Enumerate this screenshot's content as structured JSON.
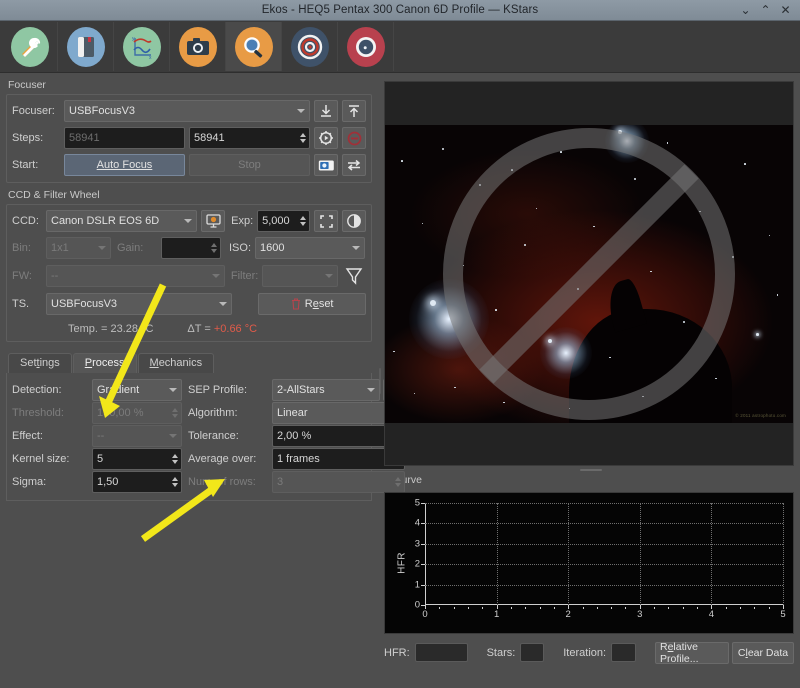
{
  "window": {
    "title": "Ekos - HEQ5 Pentax 300 Canon 6D Profile — KStars",
    "minimize_icon": "chevron-down-icon",
    "maximize_icon": "chevron-up-icon",
    "close_icon": "close-icon"
  },
  "toolbar": {
    "modules": [
      {
        "name": "setup-module",
        "icon": "wrench-screwdriver-icon"
      },
      {
        "name": "scheduler-module",
        "icon": "notebook-icon"
      },
      {
        "name": "analyze-module",
        "icon": "graph-icon"
      },
      {
        "name": "capture-module",
        "icon": "camera-icon"
      },
      {
        "name": "focus-module",
        "icon": "magnifier-icon"
      },
      {
        "name": "align-module",
        "icon": "target-icon"
      },
      {
        "name": "guide-module",
        "icon": "guide-compass-icon"
      }
    ],
    "selected_index": 4
  },
  "focuser": {
    "group_label": "Focuser",
    "device_label": "Focuser:",
    "device_value": "USBFocusV3",
    "steps_label": "Steps:",
    "steps_placeholder": "58941",
    "steps_value": "58941",
    "start_label": "Start:",
    "auto_focus_label": "Auto Focus",
    "stop_label": "Stop",
    "focus_in_icon": "arrow-down-icon",
    "focus_out_icon": "arrow-up-icon",
    "goto_icon": "gear-play-icon",
    "abort_icon": "stop-circle-icon",
    "capture_icon": "camera-capture-icon",
    "loop_icon": "loop-icon"
  },
  "ccd": {
    "group_label": "CCD & Filter Wheel",
    "ccd_label": "CCD:",
    "ccd_value": "Canon DSLR EOS 6D",
    "ccd_settings_icon": "ccd-settings-icon",
    "exp_label": "Exp:",
    "exp_value": "5,000",
    "frame_icon": "select-frame-icon",
    "toggle_full_icon": "toggle-fullfield-icon",
    "bin_label": "Bin:",
    "bin_value": "1x1",
    "gain_label": "Gain:",
    "gain_value": "",
    "iso_label": "ISO:",
    "iso_value": "1600",
    "fw_label": "FW:",
    "fw_value": "--",
    "filter_label": "Filter:",
    "filter_value": "",
    "filter_icon": "filter-funnel-icon",
    "ts_label": "TS.",
    "ts_value": "USBFocusV3",
    "reset_label": "Reset",
    "reset_icon": "trash-icon",
    "temp_text": "Temp. = 23.28 °C",
    "delta_label": "ΔT =",
    "delta_value": "+0.66 °C",
    "delta_color": "#e05b4a"
  },
  "tabs": [
    {
      "label": "Settings",
      "name": "tab-settings",
      "active": false
    },
    {
      "label": "Process",
      "name": "tab-process",
      "active": true
    },
    {
      "label": "Mechanics",
      "name": "tab-mechanics",
      "active": false
    }
  ],
  "process": {
    "detection_label": "Detection:",
    "detection_value": "Gradient",
    "sep_profile_label": "SEP Profile:",
    "sep_profile_value": "2-AllStars",
    "sep_edit_icon": "pencil-icon",
    "threshold_label": "Threshold:",
    "threshold_value": "150,00 %",
    "algorithm_label": "Algorithm:",
    "algorithm_value": "Linear",
    "effect_label": "Effect:",
    "effect_value": "--",
    "tolerance_label": "Tolerance:",
    "tolerance_value": "2,00 %",
    "kernel_label": "Kernel size:",
    "kernel_value": "5",
    "average_label": "Average over:",
    "average_value": "1 frames",
    "sigma_label": "Sigma:",
    "sigma_value": "1,50",
    "rows_label": "Num. of rows:",
    "rows_value": "3"
  },
  "preview": {
    "name": "fits-preview",
    "overlay_icon": "no-entry-icon",
    "watermark": "© 2011 astrophoto.com"
  },
  "vcurve": {
    "title": "V-Curve",
    "hfr_label": "HFR:",
    "hfr_value": "",
    "stars_label": "Stars:",
    "stars_value": "",
    "iteration_label": "Iteration:",
    "iteration_value": "",
    "relative_profile_label": "Relative Profile...",
    "clear_data_label": "Clear Data"
  },
  "chart_data": {
    "type": "scatter",
    "title": "V-Curve",
    "xlabel": "",
    "ylabel": "HFR",
    "x": [],
    "y": [],
    "xlim": [
      0,
      5
    ],
    "ylim": [
      0,
      5
    ],
    "xticks": [
      "0",
      "1",
      "2",
      "3",
      "4",
      "5"
    ],
    "yticks": [
      "0",
      "1",
      "2",
      "3",
      "4",
      "5"
    ],
    "grid": true,
    "legend": "none",
    "background": "#050505",
    "note": "empty plot - no focus data points collected"
  },
  "annotations": {
    "arrow_color": "#f2e71a",
    "arrows": [
      {
        "name": "arrow-to-process-tab",
        "points_to": "Process tab"
      },
      {
        "name": "arrow-to-tolerance",
        "points_to": "Tolerance field"
      }
    ]
  }
}
